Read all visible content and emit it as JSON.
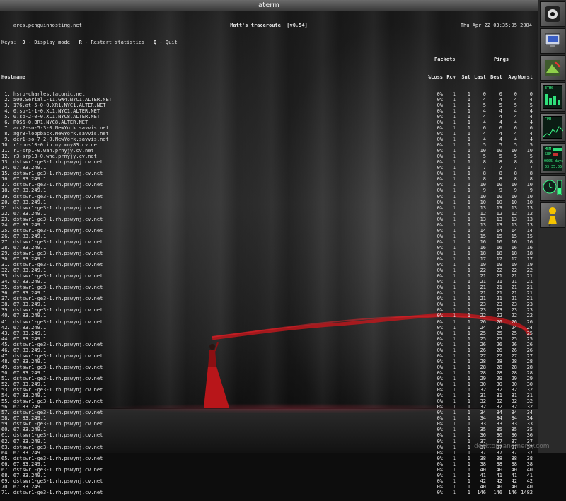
{
  "window": {
    "title": "aterm"
  },
  "terminal": {
    "host_line": "ares.penguinhosting.net",
    "program_title": "Matt's traceroute  [v0.54]",
    "clock": "Thu Apr 22 03:35:05 2004",
    "keys_label": "Keys:",
    "key_d": "D",
    "key_d_action": " - Display mode",
    "key_r": "R",
    "key_r_action": " - Restart statistics",
    "key_q": "Q",
    "key_q_action": " - Quit",
    "group_packets": "Packets",
    "group_pings": "Pings",
    "columns": {
      "hostname": "Hostname",
      "loss": "%Loss",
      "rcv": "Rcv",
      "snt": "Snt",
      "last": "Last",
      "best": "Best",
      "avg": "Avg",
      "worst": "Worst"
    },
    "hops": [
      {
        "label": " 1. hsrp-charles.taconic.net",
        "loss": "0%",
        "rcv": "1",
        "snt": "1",
        "last": "0",
        "best": "0",
        "avg": "0",
        "worst": "0"
      },
      {
        "label": " 2. 500.Serial1-11.GW4.NYC1.ALTER.NET",
        "loss": "0%",
        "rcv": "1",
        "snt": "1",
        "last": "4",
        "best": "4",
        "avg": "4",
        "worst": "4"
      },
      {
        "label": " 3. 176.at-5-0-0.XR1.NYC1.ALTER.NET",
        "loss": "0%",
        "rcv": "1",
        "snt": "1",
        "last": "5",
        "best": "5",
        "avg": "5",
        "worst": "5"
      },
      {
        "label": " 4. 0.so-1-1-0.XL1.NYC1.ALTER.NET",
        "loss": "0%",
        "rcv": "1",
        "snt": "1",
        "last": "4",
        "best": "4",
        "avg": "4",
        "worst": "4"
      },
      {
        "label": " 5. 0.so-2-0-0.XL1.NYC8.ALTER.NET",
        "loss": "0%",
        "rcv": "1",
        "snt": "1",
        "last": "4",
        "best": "4",
        "avg": "4",
        "worst": "4"
      },
      {
        "label": " 6. POS6-0.BR1.NYC8.ALTER.NET",
        "loss": "0%",
        "rcv": "1",
        "snt": "1",
        "last": "4",
        "best": "4",
        "avg": "4",
        "worst": "4"
      },
      {
        "label": " 7. acr2-so-5-3-0.NewYork.savvis.net",
        "loss": "0%",
        "rcv": "1",
        "snt": "1",
        "last": "6",
        "best": "6",
        "avg": "6",
        "worst": "6"
      },
      {
        "label": " 8. agr3-loopback.NewYork.savvis.net",
        "loss": "0%",
        "rcv": "1",
        "snt": "1",
        "last": "4",
        "best": "4",
        "avg": "4",
        "worst": "4"
      },
      {
        "label": " 9. dcr1-so-7-2-0.NewYork.savvis.net",
        "loss": "0%",
        "rcv": "1",
        "snt": "1",
        "last": "4",
        "best": "4",
        "avg": "4",
        "worst": "4"
      },
      {
        "label": "10. r1-pos10-0.in.nycmny83.cv.net",
        "loss": "0%",
        "rcv": "1",
        "snt": "1",
        "last": "5",
        "best": "5",
        "avg": "5",
        "worst": "5"
      },
      {
        "label": "11. r1-srp1-0.wan.prnyjy.cv.net",
        "loss": "0%",
        "rcv": "1",
        "snt": "1",
        "last": "10",
        "best": "10",
        "avg": "10",
        "worst": "10"
      },
      {
        "label": "12. r3-srp13-0.whe.prnyjy.cv.net",
        "loss": "0%",
        "rcv": "1",
        "snt": "1",
        "last": "5",
        "best": "5",
        "avg": "5",
        "worst": "5"
      },
      {
        "label": "13. dstswr1-ge3-1.rh.pswynj.cv.net",
        "loss": "0%",
        "rcv": "1",
        "snt": "1",
        "last": "8",
        "best": "8",
        "avg": "8",
        "worst": "8"
      },
      {
        "label": "14. 67.83.249.1",
        "loss": "0%",
        "rcv": "1",
        "snt": "1",
        "last": "7",
        "best": "7",
        "avg": "7",
        "worst": "7"
      },
      {
        "label": "15. dstswr1-ge3-1.rh.pswynj.cv.net",
        "loss": "0%",
        "rcv": "1",
        "snt": "1",
        "last": "8",
        "best": "8",
        "avg": "8",
        "worst": "8"
      },
      {
        "label": "16. 67.83.249.1",
        "loss": "0%",
        "rcv": "1",
        "snt": "1",
        "last": "8",
        "best": "8",
        "avg": "8",
        "worst": "8"
      },
      {
        "label": "17. dstswr1-ge3-1.rh.pswynj.cv.net",
        "loss": "0%",
        "rcv": "1",
        "snt": "1",
        "last": "10",
        "best": "10",
        "avg": "10",
        "worst": "10"
      },
      {
        "label": "18. 67.83.249.1",
        "loss": "0%",
        "rcv": "1",
        "snt": "1",
        "last": "9",
        "best": "9",
        "avg": "9",
        "worst": "9"
      },
      {
        "label": "19. dstswr1-ge3-1.rh.pswynj.cv.net",
        "loss": "0%",
        "rcv": "1",
        "snt": "1",
        "last": "10",
        "best": "10",
        "avg": "10",
        "worst": "10"
      },
      {
        "label": "20. 67.83.249.1",
        "loss": "0%",
        "rcv": "1",
        "snt": "1",
        "last": "10",
        "best": "10",
        "avg": "10",
        "worst": "10"
      },
      {
        "label": "21. dstswr1-ge3-1.rh.pswynj.cv.net",
        "loss": "0%",
        "rcv": "1",
        "snt": "1",
        "last": "13",
        "best": "13",
        "avg": "13",
        "worst": "13"
      },
      {
        "label": "22. 67.83.249.1",
        "loss": "0%",
        "rcv": "1",
        "snt": "1",
        "last": "12",
        "best": "12",
        "avg": "12",
        "worst": "12"
      },
      {
        "label": "23. dstswr1-ge3-1.rh.pswynj.cv.net",
        "loss": "0%",
        "rcv": "1",
        "snt": "1",
        "last": "13",
        "best": "13",
        "avg": "13",
        "worst": "13"
      },
      {
        "label": "24. 67.83.249.1",
        "loss": "0%",
        "rcv": "1",
        "snt": "1",
        "last": "13",
        "best": "13",
        "avg": "13",
        "worst": "13"
      },
      {
        "label": "25. dstswr1-ge3-1.rh.pswynj.cv.net",
        "loss": "0%",
        "rcv": "1",
        "snt": "1",
        "last": "14",
        "best": "14",
        "avg": "14",
        "worst": "14"
      },
      {
        "label": "26. 67.83.249.1",
        "loss": "0%",
        "rcv": "1",
        "snt": "1",
        "last": "15",
        "best": "15",
        "avg": "15",
        "worst": "15"
      },
      {
        "label": "27. dstswr1-ge3-1.rh.pswynj.cv.net",
        "loss": "0%",
        "rcv": "1",
        "snt": "1",
        "last": "16",
        "best": "16",
        "avg": "16",
        "worst": "16"
      },
      {
        "label": "28. 67.83.249.1",
        "loss": "0%",
        "rcv": "1",
        "snt": "1",
        "last": "16",
        "best": "16",
        "avg": "16",
        "worst": "16"
      },
      {
        "label": "29. dstswr1-ge3-1.rh.pswynj.cv.net",
        "loss": "0%",
        "rcv": "1",
        "snt": "1",
        "last": "18",
        "best": "18",
        "avg": "18",
        "worst": "18"
      },
      {
        "label": "30. 67.83.249.1",
        "loss": "0%",
        "rcv": "1",
        "snt": "1",
        "last": "17",
        "best": "17",
        "avg": "17",
        "worst": "17"
      },
      {
        "label": "31. dstswr1-ge3-1.rh.pswynj.cv.net",
        "loss": "0%",
        "rcv": "1",
        "snt": "1",
        "last": "19",
        "best": "19",
        "avg": "19",
        "worst": "19"
      },
      {
        "label": "32. 67.83.249.1",
        "loss": "0%",
        "rcv": "1",
        "snt": "1",
        "last": "22",
        "best": "22",
        "avg": "22",
        "worst": "22"
      },
      {
        "label": "33. dstswr1-ge3-1.rh.pswynj.cv.net",
        "loss": "0%",
        "rcv": "1",
        "snt": "1",
        "last": "21",
        "best": "21",
        "avg": "21",
        "worst": "21"
      },
      {
        "label": "34. 67.83.249.1",
        "loss": "0%",
        "rcv": "1",
        "snt": "1",
        "last": "21",
        "best": "21",
        "avg": "21",
        "worst": "21"
      },
      {
        "label": "35. dstswr1-ge3-1.rh.pswynj.cv.net",
        "loss": "0%",
        "rcv": "1",
        "snt": "1",
        "last": "21",
        "best": "21",
        "avg": "21",
        "worst": "21"
      },
      {
        "label": "36. 67.83.249.1",
        "loss": "0%",
        "rcv": "1",
        "snt": "1",
        "last": "21",
        "best": "21",
        "avg": "21",
        "worst": "21"
      },
      {
        "label": "37. dstswr1-ge3-1.rh.pswynj.cv.net",
        "loss": "0%",
        "rcv": "1",
        "snt": "1",
        "last": "21",
        "best": "21",
        "avg": "21",
        "worst": "21"
      },
      {
        "label": "38. 67.83.249.1",
        "loss": "0%",
        "rcv": "1",
        "snt": "1",
        "last": "23",
        "best": "23",
        "avg": "23",
        "worst": "23"
      },
      {
        "label": "39. dstswr1-ge3-1.rh.pswynj.cv.net",
        "loss": "0%",
        "rcv": "1",
        "snt": "1",
        "last": "23",
        "best": "23",
        "avg": "23",
        "worst": "23"
      },
      {
        "label": "40. 67.83.249.1",
        "loss": "0%",
        "rcv": "1",
        "snt": "1",
        "last": "22",
        "best": "22",
        "avg": "22",
        "worst": "22"
      },
      {
        "label": "41. dstswr1-ge3-1.rh.pswynj.cv.net",
        "loss": "0%",
        "rcv": "1",
        "snt": "1",
        "last": "26",
        "best": "26",
        "avg": "26",
        "worst": "26"
      },
      {
        "label": "42. 67.83.249.1",
        "loss": "0%",
        "rcv": "1",
        "snt": "1",
        "last": "24",
        "best": "24",
        "avg": "24",
        "worst": "24"
      },
      {
        "label": "43. 67.83.249.1",
        "loss": "0%",
        "rcv": "1",
        "snt": "1",
        "last": "25",
        "best": "25",
        "avg": "25",
        "worst": "25"
      },
      {
        "label": "44. 67.83.249.1",
        "loss": "0%",
        "rcv": "1",
        "snt": "1",
        "last": "25",
        "best": "25",
        "avg": "25",
        "worst": "25"
      },
      {
        "label": "45. dstswr1-ge3-1.rh.pswynj.cv.net",
        "loss": "0%",
        "rcv": "1",
        "snt": "1",
        "last": "26",
        "best": "26",
        "avg": "26",
        "worst": "26"
      },
      {
        "label": "46. 67.83.249.1",
        "loss": "0%",
        "rcv": "1",
        "snt": "1",
        "last": "26",
        "best": "26",
        "avg": "26",
        "worst": "26"
      },
      {
        "label": "47. dstswr1-ge3-1.rh.pswynj.cv.net",
        "loss": "0%",
        "rcv": "1",
        "snt": "1",
        "last": "27",
        "best": "27",
        "avg": "27",
        "worst": "27"
      },
      {
        "label": "48. 67.83.249.1",
        "loss": "0%",
        "rcv": "1",
        "snt": "1",
        "last": "28",
        "best": "28",
        "avg": "28",
        "worst": "28"
      },
      {
        "label": "49. dstswr1-ge3-1.rh.pswynj.cv.net",
        "loss": "0%",
        "rcv": "1",
        "snt": "1",
        "last": "28",
        "best": "28",
        "avg": "28",
        "worst": "28"
      },
      {
        "label": "50. 67.83.249.1",
        "loss": "0%",
        "rcv": "1",
        "snt": "1",
        "last": "28",
        "best": "28",
        "avg": "28",
        "worst": "28"
      },
      {
        "label": "51. dstswr1-ge3-1.rh.pswynj.cv.net",
        "loss": "0%",
        "rcv": "1",
        "snt": "1",
        "last": "29",
        "best": "29",
        "avg": "29",
        "worst": "29"
      },
      {
        "label": "52. 67.83.249.1",
        "loss": "0%",
        "rcv": "1",
        "snt": "1",
        "last": "30",
        "best": "30",
        "avg": "30",
        "worst": "30"
      },
      {
        "label": "53. dstswr1-ge3-1.rh.pswynj.cv.net",
        "loss": "0%",
        "rcv": "1",
        "snt": "1",
        "last": "32",
        "best": "32",
        "avg": "32",
        "worst": "32"
      },
      {
        "label": "54. 67.83.249.1",
        "loss": "0%",
        "rcv": "1",
        "snt": "1",
        "last": "31",
        "best": "31",
        "avg": "31",
        "worst": "31"
      },
      {
        "label": "55. dstswr1-ge3-1.rh.pswynj.cv.net",
        "loss": "0%",
        "rcv": "1",
        "snt": "1",
        "last": "32",
        "best": "32",
        "avg": "32",
        "worst": "32"
      },
      {
        "label": "56. 67.83.249.1",
        "loss": "0%",
        "rcv": "1",
        "snt": "1",
        "last": "32",
        "best": "32",
        "avg": "32",
        "worst": "32"
      },
      {
        "label": "57. dstswr1-ge3-1.rh.pswynj.cv.net",
        "loss": "0%",
        "rcv": "1",
        "snt": "1",
        "last": "34",
        "best": "34",
        "avg": "34",
        "worst": "34"
      },
      {
        "label": "58. 67.83.249.1",
        "loss": "0%",
        "rcv": "1",
        "snt": "1",
        "last": "34",
        "best": "34",
        "avg": "34",
        "worst": "34"
      },
      {
        "label": "59. dstswr1-ge3-1.rh.pswynj.cv.net",
        "loss": "0%",
        "rcv": "1",
        "snt": "1",
        "last": "33",
        "best": "33",
        "avg": "33",
        "worst": "33"
      },
      {
        "label": "60. 67.83.249.1",
        "loss": "0%",
        "rcv": "1",
        "snt": "1",
        "last": "35",
        "best": "35",
        "avg": "35",
        "worst": "35"
      },
      {
        "label": "61. dstswr1-ge3-1.rh.pswynj.cv.net",
        "loss": "0%",
        "rcv": "1",
        "snt": "1",
        "last": "36",
        "best": "36",
        "avg": "36",
        "worst": "36"
      },
      {
        "label": "62. 67.83.249.1",
        "loss": "0%",
        "rcv": "1",
        "snt": "1",
        "last": "37",
        "best": "37",
        "avg": "37",
        "worst": "37"
      },
      {
        "label": "63. dstswr1-ge3-1.rh.pswynj.cv.net",
        "loss": "0%",
        "rcv": "1",
        "snt": "1",
        "last": "37",
        "best": "37",
        "avg": "37",
        "worst": "37"
      },
      {
        "label": "64. 67.83.249.1",
        "loss": "0%",
        "rcv": "1",
        "snt": "1",
        "last": "37",
        "best": "37",
        "avg": "37",
        "worst": "37"
      },
      {
        "label": "65. dstswr1-ge3-1.rh.pswynj.cv.net",
        "loss": "0%",
        "rcv": "1",
        "snt": "1",
        "last": "38",
        "best": "38",
        "avg": "38",
        "worst": "38"
      },
      {
        "label": "66. 67.83.249.1",
        "loss": "0%",
        "rcv": "1",
        "snt": "1",
        "last": "38",
        "best": "38",
        "avg": "38",
        "worst": "38"
      },
      {
        "label": "67. dstswr1-ge3-1.rh.pswynj.cv.net",
        "loss": "0%",
        "rcv": "1",
        "snt": "1",
        "last": "40",
        "best": "40",
        "avg": "40",
        "worst": "40"
      },
      {
        "label": "68. 67.83.249.1",
        "loss": "0%",
        "rcv": "1",
        "snt": "1",
        "last": "41",
        "best": "41",
        "avg": "41",
        "worst": "41"
      },
      {
        "label": "69. dstswr1-ge3-1.rh.pswynj.cv.net",
        "loss": "0%",
        "rcv": "1",
        "snt": "1",
        "last": "42",
        "best": "42",
        "avg": "42",
        "worst": "42"
      },
      {
        "label": "70. 67.83.249.1",
        "loss": "0%",
        "rcv": "1",
        "snt": "1",
        "last": "40",
        "best": "40",
        "avg": "40",
        "worst": "40"
      },
      {
        "label": "71. dstswr1-ge3-1.rh.pswynj.cv.net",
        "loss": "0%",
        "rcv": "1",
        "snt": "1",
        "last": "146",
        "best": "146",
        "avg": "146",
        "worst": "1482"
      }
    ]
  },
  "dock": {
    "apps": [
      {
        "name": "gimp-eye-icon"
      },
      {
        "name": "monitor-icon"
      },
      {
        "name": "image-viewer-icon"
      },
      {
        "name": "system-monitor-icon"
      },
      {
        "name": "cpu-meter-icon"
      },
      {
        "name": "memory-uptime-icon"
      },
      {
        "name": "clock-gauge-icon"
      },
      {
        "name": "instant-messenger-icon"
      }
    ],
    "monitor": {
      "label_cpu": "CPU",
      "label_mem": "MEM",
      "label_swp": "SWP",
      "uptime": "0005 days",
      "time": "03:35:05"
    }
  },
  "watermark": {
    "text": "desktopsanomemy.com"
  },
  "colors": {
    "titlebar": "#4a4a4a",
    "terminal_text": "#e6e6e6",
    "ribbon": "#c4161c",
    "dock_led": "#3cff8a"
  }
}
